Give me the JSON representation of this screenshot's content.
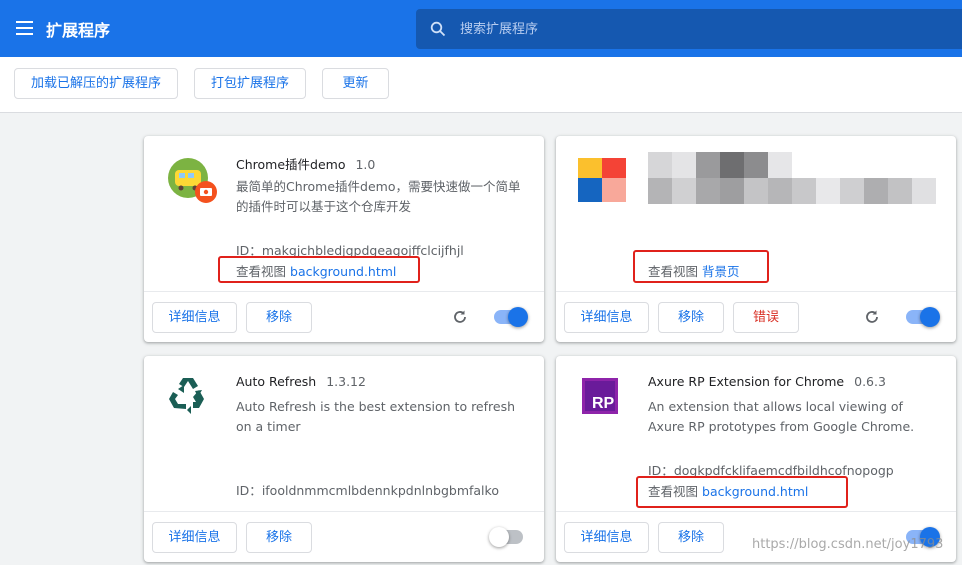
{
  "header": {
    "title": "扩展程序",
    "search_placeholder": "搜索扩展程序"
  },
  "toolbar": {
    "load_unpacked": "加载已解压的扩展程序",
    "pack": "打包扩展程序",
    "update": "更新"
  },
  "extensions": [
    {
      "name": "Chrome插件demo",
      "version": "1.0",
      "description": "最简单的Chrome插件demo，需要快速做一个简单的插件时可以基于这个仓库开发",
      "id_label": "ID：",
      "id": "makgjchbledjgpdgeagojffclcijfhjl",
      "views_label": "查看视图",
      "view_link": "background.html",
      "details_label": "详细信息",
      "remove_label": "移除",
      "enabled": true,
      "icon": "train-icon"
    },
    {
      "views_label": "查看视图",
      "view_link": "背景页",
      "details_label": "详细信息",
      "remove_label": "移除",
      "errors_label": "错误",
      "enabled": true,
      "icon": "colorful-blocks-icon"
    },
    {
      "name": "Auto Refresh",
      "version": "1.3.12",
      "description": "Auto Refresh is the best extension to refresh on a timer",
      "id_label": "ID：",
      "id": "ifooldnmmcmlbdennkpdnlnbgbmfalko",
      "details_label": "详细信息",
      "remove_label": "移除",
      "enabled": false,
      "icon": "recycle-icon"
    },
    {
      "name": "Axure RP Extension for Chrome",
      "version": "0.6.3",
      "description": "An extension that allows local viewing of Axure RP prototypes from Google Chrome.",
      "id_label": "ID：",
      "id": "dogkpdfcklifaemcdfbildhcofnopogp",
      "views_label": "查看视图",
      "view_link": "background.html",
      "details_label": "详细信息",
      "remove_label": "移除",
      "enabled": true,
      "icon": "axure-rp-icon",
      "icon_text": "RP"
    }
  ],
  "watermark": "https://blog.csdn.net/joy1793",
  "colors": {
    "accent": "#1a73e8",
    "header_bg": "#1a73e8",
    "error": "#d93025",
    "annotation_red": "#e0211b"
  }
}
